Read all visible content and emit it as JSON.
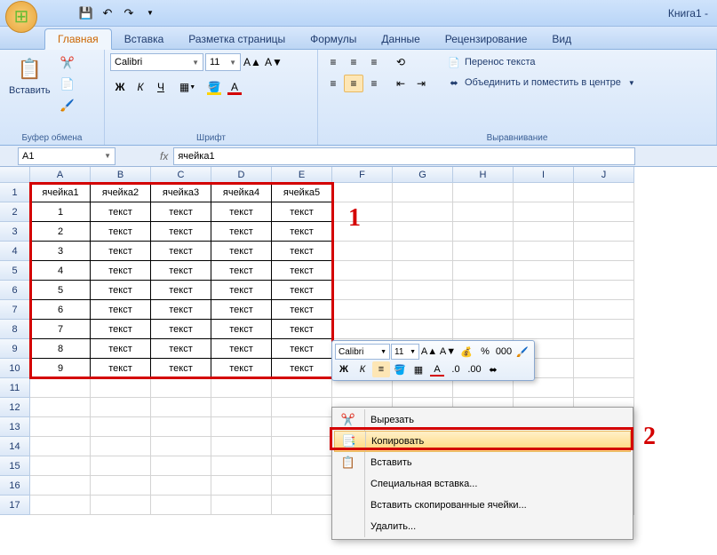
{
  "window": {
    "title": "Книга1 -"
  },
  "qat": {
    "save": "save",
    "undo": "undo",
    "redo": "redo"
  },
  "tabs": [
    "Главная",
    "Вставка",
    "Разметка страницы",
    "Формулы",
    "Данные",
    "Рецензирование",
    "Вид"
  ],
  "active_tab": 0,
  "ribbon": {
    "clipboard": {
      "label": "Буфер обмена",
      "paste": "Вставить"
    },
    "font": {
      "label": "Шрифт",
      "name": "Calibri",
      "size": "11",
      "bold": "Ж",
      "italic": "К",
      "underline": "Ч"
    },
    "alignment": {
      "label": "Выравнивание",
      "wrap": "Перенос текста",
      "merge": "Объединить и поместить в центре"
    }
  },
  "name_box": "A1",
  "formula": "ячейка1",
  "columns": [
    "A",
    "B",
    "C",
    "D",
    "E",
    "F",
    "G",
    "H",
    "I",
    "J"
  ],
  "rows": [
    1,
    2,
    3,
    4,
    5,
    6,
    7,
    8,
    9,
    10,
    11,
    12,
    13,
    14,
    15,
    16,
    17
  ],
  "table": {
    "header": [
      "ячейка1",
      "ячейка2",
      "ячейка3",
      "ячейка4",
      "ячейка5"
    ],
    "rows": [
      [
        "1",
        "текст",
        "текст",
        "текст",
        "текст"
      ],
      [
        "2",
        "текст",
        "текст",
        "текст",
        "текст"
      ],
      [
        "3",
        "текст",
        "текст",
        "текст",
        "текст"
      ],
      [
        "4",
        "текст",
        "текст",
        "текст",
        "текст"
      ],
      [
        "5",
        "текст",
        "текст",
        "текст",
        "текст"
      ],
      [
        "6",
        "текст",
        "текст",
        "текст",
        "текст"
      ],
      [
        "7",
        "текст",
        "текст",
        "текст",
        "текст"
      ],
      [
        "8",
        "текст",
        "текст",
        "текст",
        "текст"
      ],
      [
        "9",
        "текст",
        "текст",
        "текст",
        "текст"
      ]
    ]
  },
  "annotations": {
    "one": "1",
    "two": "2"
  },
  "mini_toolbar": {
    "font": "Calibri",
    "size": "11",
    "bold": "Ж",
    "italic": "К",
    "percent": "%",
    "zeros": "000"
  },
  "context_menu": {
    "cut": "Вырезать",
    "copy": "Копировать",
    "paste": "Вставить",
    "paste_special": "Специальная вставка...",
    "insert_copied": "Вставить скопированные ячейки...",
    "delete": "Удалить..."
  }
}
